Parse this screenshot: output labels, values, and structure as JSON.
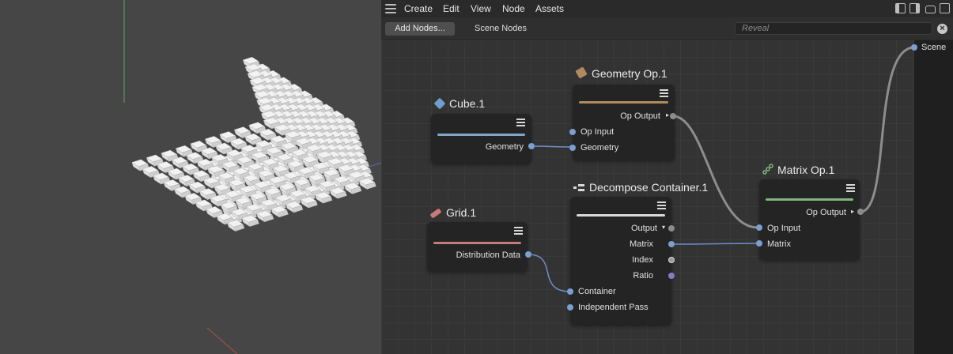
{
  "menubar": {
    "items": [
      "Create",
      "Edit",
      "View",
      "Node",
      "Assets"
    ]
  },
  "toolbar": {
    "add_nodes_label": "Add Nodes...",
    "scene_nodes_label": "Scene Nodes",
    "reveal_placeholder": "Reveal"
  },
  "nodes": {
    "cube": {
      "title": "Cube.1",
      "out_geometry": "Geometry",
      "accent": "#7ea7c9"
    },
    "geometry_op": {
      "title": "Geometry Op.1",
      "op_output": "Op Output",
      "op_input": "Op Input",
      "geometry": "Geometry",
      "accent": "#b08a5f"
    },
    "grid": {
      "title": "Grid.1",
      "distribution_data": "Distribution Data",
      "accent": "#c77b78"
    },
    "decompose": {
      "title": "Decompose Container.1",
      "output": "Output",
      "matrix": "Matrix",
      "index": "Index",
      "ratio": "Ratio",
      "container": "Container",
      "independent_pass": "Independent Pass",
      "accent": "#d9d9d9"
    },
    "matrix_op": {
      "title": "Matrix Op.1",
      "op_output": "Op Output",
      "op_input": "Op Input",
      "matrix": "Matrix",
      "accent": "#7fb77e"
    }
  },
  "scene_port": {
    "label": "Scene"
  },
  "colors": {
    "port_blue": "#7c9fd0",
    "port_gray": "#8c8c8c",
    "port_purple": "#8a79c4",
    "wire_gray": "#8d8d8d",
    "wire_blue": "#6f8fc4"
  }
}
